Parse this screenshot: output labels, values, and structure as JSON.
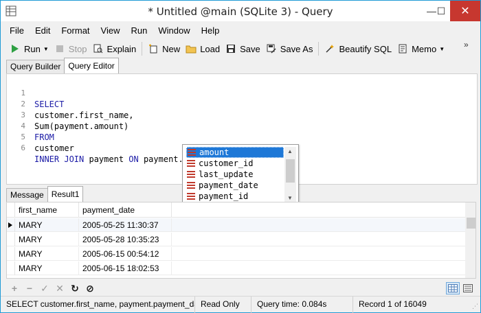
{
  "window": {
    "title": "* Untitled @main (SQLite 3) - Query",
    "min_glyph": "—",
    "max_glyph": "☐",
    "close_glyph": "✕"
  },
  "menu": [
    "File",
    "Edit",
    "Format",
    "View",
    "Run",
    "Window",
    "Help"
  ],
  "toolbar": {
    "run": "Run",
    "stop": "Stop",
    "explain": "Explain",
    "new": "New",
    "load": "Load",
    "save": "Save",
    "save_as": "Save As",
    "beautify": "Beautify SQL",
    "memo": "Memo",
    "overflow": "»"
  },
  "editor_tabs": [
    "Query Builder",
    "Query Editor"
  ],
  "editor": {
    "line_numbers": [
      "1",
      "2",
      "3",
      "4",
      "5",
      "6"
    ],
    "lines": [
      "SELECT",
      "customer.first_name,",
      "Sum(payment.amount)",
      "FROM",
      "customer",
      "INNER JOIN payment ON payment."
    ],
    "line6": {
      "kw1": "INNER JOIN",
      "t1": " payment ",
      "kw2": "ON",
      "t2": " payment."
    }
  },
  "autocomplete": {
    "items": [
      "amount",
      "customer_id",
      "last_update",
      "payment_date",
      "payment_id"
    ],
    "selected": "amount",
    "arrow_up": "▲",
    "arrow_down": "▼"
  },
  "result_tabs": [
    "Message",
    "Result1"
  ],
  "grid": {
    "columns": [
      "first_name",
      "payment_date"
    ],
    "rows": [
      [
        "MARY",
        "2005-05-25 11:30:37"
      ],
      [
        "MARY",
        "2005-05-28 10:35:23"
      ],
      [
        "MARY",
        "2005-06-15 00:54:12"
      ],
      [
        "MARY",
        "2005-06-15 18:02:53"
      ]
    ]
  },
  "navbar": {
    "add": "+",
    "delete": "−",
    "apply": "✓",
    "cancel": "✕",
    "refresh": "↻",
    "stop": "⊘"
  },
  "status": {
    "sql": "SELECT customer.first_name, payment.payment_date",
    "mode": "Read Only",
    "time": "Query time: 0.084s",
    "record": "Record 1 of 16049"
  },
  "colors": {
    "accent": "#1f9ad6",
    "keyword": "#1a1aa6",
    "selection": "#1e78d7",
    "close": "#c7372f"
  }
}
